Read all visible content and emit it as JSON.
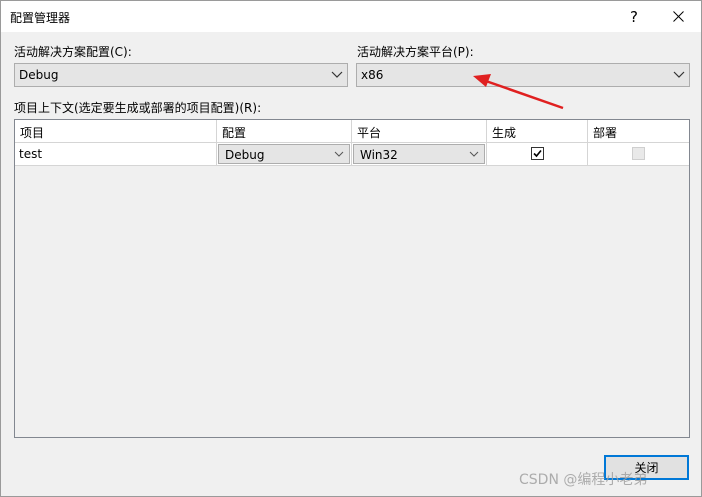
{
  "window": {
    "title": "配置管理器",
    "help_label": "?",
    "close_label": "✕"
  },
  "solution_config": {
    "label": "活动解决方案配置(C):",
    "value": "Debug"
  },
  "solution_platform": {
    "label": "活动解决方案平台(P):",
    "value": "x86"
  },
  "project_contexts": {
    "label": "项目上下文(选定要生成或部署的项目配置)(R):",
    "columns": [
      "项目",
      "配置",
      "平台",
      "生成",
      "部署"
    ],
    "rows": [
      {
        "project": "test",
        "configuration": "Debug",
        "platform": "Win32",
        "build": true,
        "deploy": false,
        "deploy_enabled": false
      }
    ]
  },
  "buttons": {
    "close_label": "关闭"
  },
  "watermark": "CSDN @编程小老弟",
  "colors": {
    "annotation_arrow": "#e02020",
    "accent_border": "#0078d7"
  },
  "icons": {
    "dropdown": "chevron-down-icon",
    "checkbox": "checkmark-icon"
  }
}
